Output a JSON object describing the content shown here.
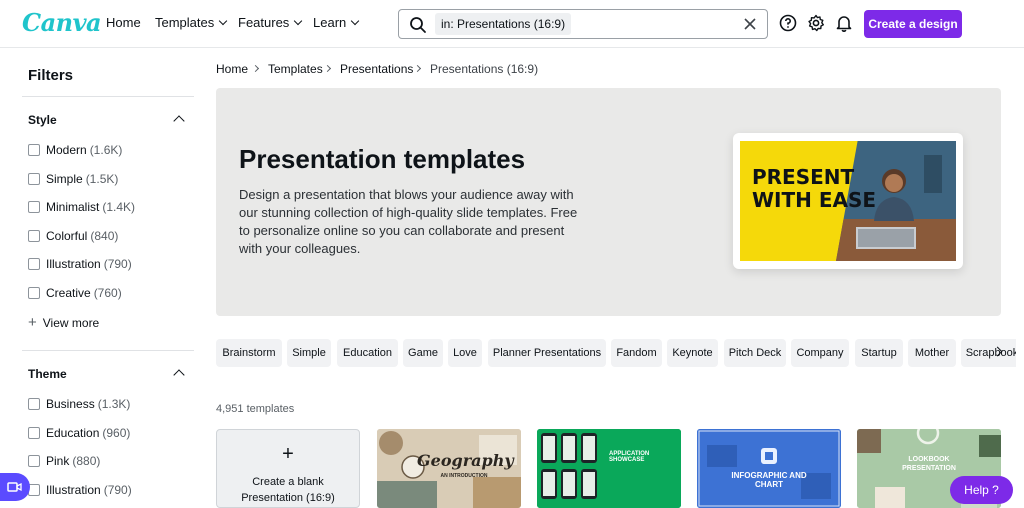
{
  "brand": {
    "logo_text": "Canva",
    "accent": "#7d2ae8"
  },
  "nav": {
    "home": "Home",
    "templates": "Templates",
    "features": "Features",
    "learn": "Learn"
  },
  "search": {
    "value": "in: Presentations (16:9)"
  },
  "header": {
    "create_label": "Create a design"
  },
  "sidebar": {
    "title": "Filters",
    "style": {
      "title": "Style",
      "options": [
        {
          "label": "Modern",
          "count": "(1.6K)"
        },
        {
          "label": "Simple",
          "count": "(1.5K)"
        },
        {
          "label": "Minimalist",
          "count": "(1.4K)"
        },
        {
          "label": "Colorful",
          "count": "(840)"
        },
        {
          "label": "Illustration",
          "count": "(790)"
        },
        {
          "label": "Creative",
          "count": "(760)"
        }
      ],
      "view_more": "View more"
    },
    "theme": {
      "title": "Theme",
      "options": [
        {
          "label": "Business",
          "count": "(1.3K)"
        },
        {
          "label": "Education",
          "count": "(960)"
        },
        {
          "label": "Pink",
          "count": "(880)"
        },
        {
          "label": "Illustration",
          "count": "(790)"
        }
      ]
    }
  },
  "breadcrumb": [
    "Home",
    "Templates",
    "Presentations",
    "Presentations (16:9)"
  ],
  "hero": {
    "title": "Presentation templates",
    "description": "Design a presentation that blows your audience away with our stunning collection of high-quality slide templates. Free to personalize online so you can collaborate and present with your colleagues.",
    "preview_line1": "PRESENT",
    "preview_line2": "WITH EASE"
  },
  "chips": [
    "Brainstorm",
    "Simple",
    "Education",
    "Game",
    "Love",
    "Planner Presentations",
    "Fandom",
    "Keynote",
    "Pitch Deck",
    "Company",
    "Startup",
    "Mother",
    "Scrapbook"
  ],
  "results": {
    "count": "4,951 templates"
  },
  "blank_card": {
    "line1": "Create a blank",
    "line2": "Presentation (16:9)"
  },
  "templates": [
    {
      "title": "Geography",
      "subtitle": "AN INTRODUCTION"
    },
    {
      "title": "APPLICATION SHOWCASE",
      "subtitle": ""
    },
    {
      "title": "INFOGRAPHIC AND CHART",
      "subtitle": ""
    },
    {
      "title": "LOOKBOOK PRESENTATION",
      "subtitle": ""
    }
  ],
  "help": {
    "label": "Help ?"
  }
}
